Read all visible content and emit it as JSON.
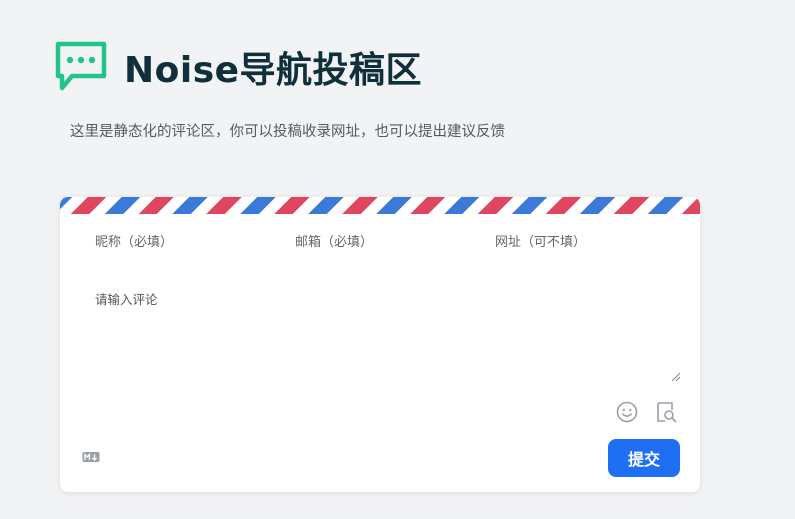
{
  "header": {
    "title": "Noise导航投稿区",
    "subtitle": "这里是静态化的评论区，你可以投稿收录网址，也可以提出建议反馈",
    "logo_icon": "chat-bubble-icon",
    "logo_color": "#22c48a"
  },
  "form": {
    "nickname_placeholder": "昵称（必填）",
    "email_placeholder": "邮箱（必填）",
    "website_placeholder": "网址（可不填）",
    "comment_placeholder": "请输入评论",
    "submit_label": "提交",
    "icons": [
      "emoji-icon",
      "preview-icon",
      "markdown-icon"
    ]
  },
  "colors": {
    "background": "#f2f3f5",
    "accent": "#1f6ff2",
    "stripe_red": "#e14660",
    "stripe_blue": "#3b7ad9",
    "title": "#0f2f3a"
  }
}
